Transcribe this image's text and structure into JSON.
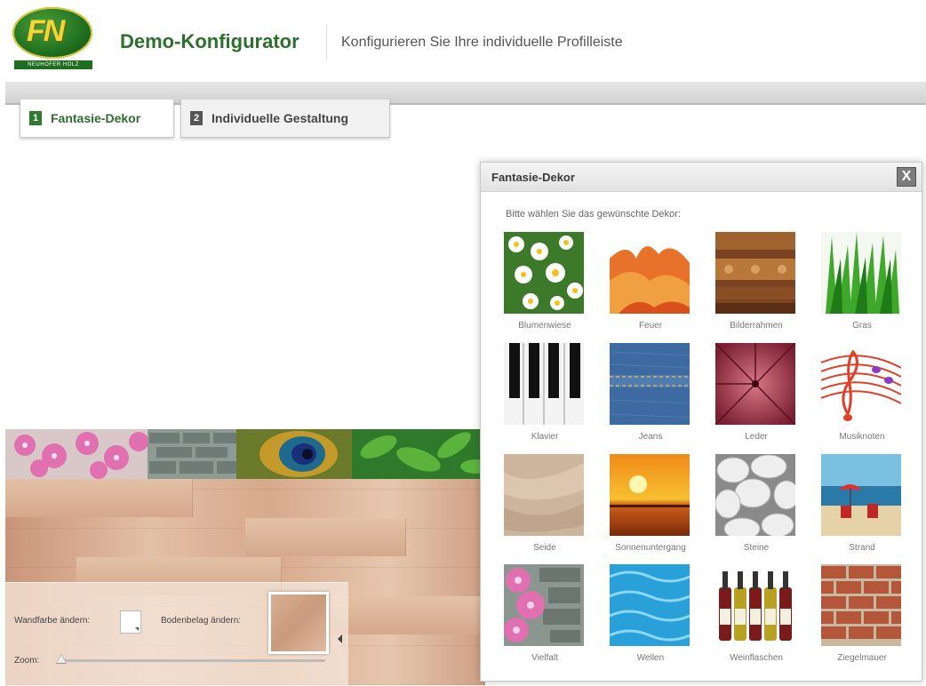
{
  "header": {
    "logo_text": "FN",
    "logo_strip": "NEUHOFER HOLZ",
    "title": "Demo-Konfigurator",
    "subtitle": "Konfigurieren Sie Ihre individuelle Profilleiste"
  },
  "tabs": [
    {
      "number": "1",
      "label": "Fantasie-Dekor",
      "active": true
    },
    {
      "number": "2",
      "label": "Individuelle Gestaltung",
      "active": false
    }
  ],
  "controls": {
    "wall_color_label": "Wandfarbe ändern:",
    "floor_label": "Bodenbelag ändern:",
    "zoom_label": "Zoom:",
    "zoom_value": 0.0
  },
  "dialog": {
    "title": "Fantasie-Dekor",
    "close_symbol": "X",
    "instruction": "Bitte wählen Sie das gewünschte Dekor:",
    "items": [
      {
        "label": "Blumenwiese",
        "icon": "daisy-field"
      },
      {
        "label": "Feuer",
        "icon": "fire"
      },
      {
        "label": "Bilderrahmen",
        "icon": "picture-frame"
      },
      {
        "label": "Gras",
        "icon": "grass"
      },
      {
        "label": "Klavier",
        "icon": "piano-keys"
      },
      {
        "label": "Jeans",
        "icon": "denim"
      },
      {
        "label": "Leder",
        "icon": "leather"
      },
      {
        "label": "Musiknoten",
        "icon": "music-notes"
      },
      {
        "label": "Seide",
        "icon": "silk"
      },
      {
        "label": "Sonnenuntergang",
        "icon": "sunset"
      },
      {
        "label": "Steine",
        "icon": "pebbles"
      },
      {
        "label": "Strand",
        "icon": "beach"
      },
      {
        "label": "Vielfalt",
        "icon": "orchid-stone"
      },
      {
        "label": "Wellen",
        "icon": "water-waves"
      },
      {
        "label": "Weinflaschen",
        "icon": "wine-bottles"
      },
      {
        "label": "Ziegelmauer",
        "icon": "brick-wall"
      }
    ]
  }
}
